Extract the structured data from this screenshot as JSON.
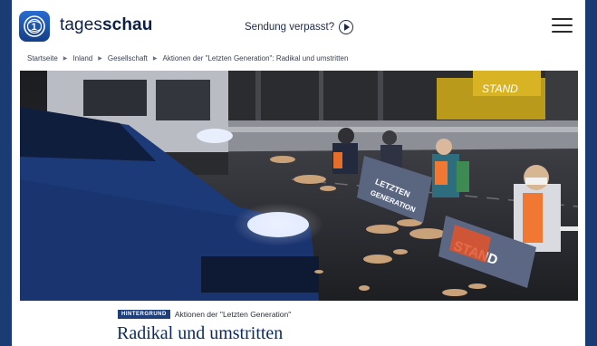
{
  "header": {
    "brand_light": "tages",
    "brand_bold": "schau",
    "missed_label": "Sendung verpasst?"
  },
  "breadcrumb": [
    "Startseite",
    "Inland",
    "Gesellschaft",
    "Aktionen der \"Letzten Generation\": Radikal und umstritten"
  ],
  "hero": {
    "banner_text_1": "LETZTEN",
    "banner_text_2": "GENERATION",
    "banner_text_3": "STAND"
  },
  "article": {
    "tag": "HINTERGRUND",
    "kicker": "Aktionen der \"Letzten Generation\"",
    "headline": "Radikal und umstritten"
  },
  "colors": {
    "outer_background": "#1a3b74",
    "brand_blue": "#0c2a5c",
    "tag_background": "#1f3f7a"
  },
  "icons": [
    "tagesschau-logo-icon",
    "play-circle-icon",
    "hamburger-menu-icon",
    "breadcrumb-arrow-icon"
  ]
}
